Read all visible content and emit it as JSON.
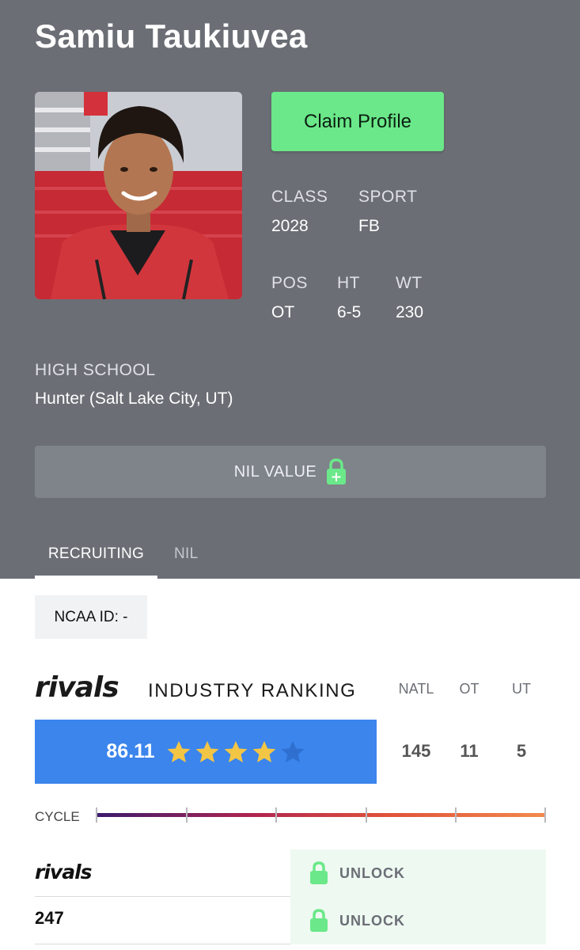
{
  "profile": {
    "name": "Samiu Taukiuvea",
    "claim_label": "Claim Profile",
    "photo_alt": "Player photo"
  },
  "attributes": {
    "class_label": "CLASS",
    "class_value": "2028",
    "sport_label": "SPORT",
    "sport_value": "FB",
    "pos_label": "POS",
    "pos_value": "OT",
    "ht_label": "HT",
    "ht_value": "6-5",
    "wt_label": "WT",
    "wt_value": "230",
    "school_label": "HIGH SCHOOL",
    "school_value": "Hunter (Salt Lake City, UT)"
  },
  "nil": {
    "label": "NIL VALUE",
    "icon": "lock-plus-icon"
  },
  "tabs": [
    {
      "label": "RECRUITING",
      "active": true
    },
    {
      "label": "NIL",
      "active": false
    }
  ],
  "ncaa": {
    "text": "NCAA ID:  -"
  },
  "ranking": {
    "logo_text": "rivals",
    "title": "INDUSTRY RANKING",
    "score": "86.11",
    "stars_filled": 4,
    "stars_total": 5,
    "columns": [
      {
        "label": "NATL",
        "value": "145"
      },
      {
        "label": "OT",
        "value": "11"
      },
      {
        "label": "UT",
        "value": "5"
      }
    ]
  },
  "cycle": {
    "label": "CYCLE"
  },
  "services": [
    {
      "name": "rivals",
      "unlock_label": "UNLOCK"
    },
    {
      "name": "247",
      "unlock_label": "UNLOCK"
    }
  ],
  "colors": {
    "hero_bg": "#6b6e75",
    "accent_green": "#6be889",
    "score_blue": "#3b85ec",
    "star_gold": "#f3c545",
    "star_empty": "#2f6fcf"
  }
}
